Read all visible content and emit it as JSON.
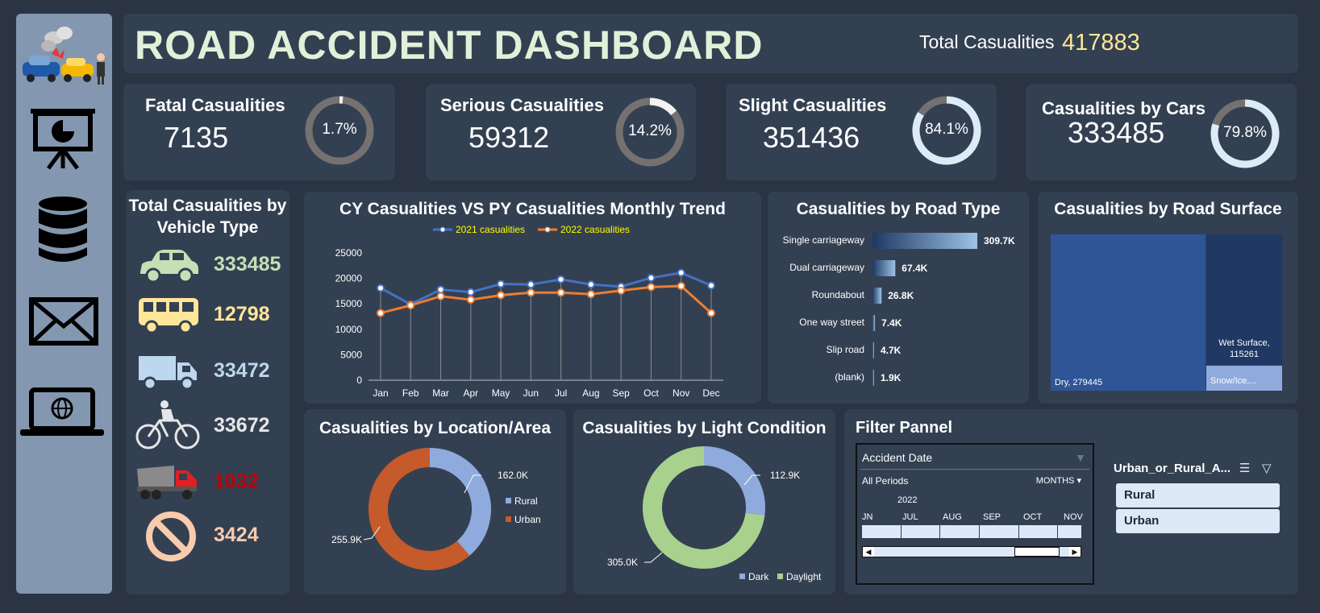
{
  "header": {
    "title": "ROAD ACCIDENT DASHBOARD",
    "total_label": "Total Casualities",
    "total_value": "417883"
  },
  "sidebar": {
    "icons": [
      "crash-logo-icon",
      "presentation-chart-icon",
      "database-icon",
      "mail-icon",
      "laptop-globe-icon"
    ]
  },
  "kpis": {
    "fatal": {
      "title": "Fatal Casualities",
      "value": "7135",
      "pct_label": "1.7%",
      "pct": 1.7
    },
    "serious": {
      "title": "Serious Casualities",
      "value": "59312",
      "pct_label": "14.2%",
      "pct": 14.2
    },
    "slight": {
      "title": "Slight Casualities",
      "value": "351436",
      "pct_label": "84.1%",
      "pct": 84.1
    },
    "cars": {
      "title": "Casualities by Cars",
      "value": "333485",
      "pct_label": "79.8%",
      "pct": 79.8
    }
  },
  "vehicles": {
    "title": "Total Casualities by Vehicle Type",
    "items": [
      {
        "icon": "car-icon",
        "value": "333485",
        "color": "#c5e0b4"
      },
      {
        "icon": "bus-icon",
        "value": "12798",
        "color": "#ffe699"
      },
      {
        "icon": "truck-icon",
        "value": "33472",
        "color": "#bdd7ee"
      },
      {
        "icon": "bicycle-icon",
        "value": "33672",
        "color": "#e7e6e6"
      },
      {
        "icon": "dump-truck-icon",
        "value": "1032",
        "color": "#c00000"
      },
      {
        "icon": "prohibited-icon",
        "value": "3424",
        "color": "#f8cbad"
      }
    ]
  },
  "chart_data": [
    {
      "type": "line",
      "title": "CY Casualities VS PY Casualities Monthly Trend",
      "categories": [
        "Jan",
        "Feb",
        "Mar",
        "Apr",
        "May",
        "Jun",
        "Jul",
        "Aug",
        "Sep",
        "Oct",
        "Nov",
        "Dec"
      ],
      "series": [
        {
          "name": "2021 casualities",
          "color": "#4472c4",
          "values": [
            18100,
            14900,
            17800,
            17300,
            18900,
            18800,
            19800,
            18800,
            18400,
            20100,
            21100,
            18600
          ]
        },
        {
          "name": "2022 casualities",
          "color": "#ed7d31",
          "values": [
            13200,
            14700,
            16500,
            15800,
            16700,
            17200,
            17200,
            16900,
            17600,
            18300,
            18500,
            13200
          ]
        }
      ],
      "ylim": [
        0,
        25000
      ],
      "yticks": [
        "25000",
        "20000",
        "15000",
        "10000",
        "5000",
        "0"
      ],
      "legend": "top"
    },
    {
      "type": "bar",
      "title": "Casualities by Road Type",
      "categories": [
        "Single carriageway",
        "Dual carriageway",
        "Roundabout",
        "One way street",
        "Slip road",
        "(blank)"
      ],
      "values": [
        309.7,
        67.4,
        26.8,
        7.4,
        4.7,
        1.9
      ],
      "labels": [
        "309.7K",
        "67.4K",
        "26.8K",
        "7.4K",
        "4.7K",
        "1.9K"
      ]
    },
    {
      "type": "heatmap",
      "title": "Casualities by Road Surface",
      "labels": [
        "Dry, 279445",
        "Wet Surface,",
        "115261",
        "Snow/Ice,..."
      ],
      "values": [
        279445,
        115261,
        22000
      ]
    },
    {
      "type": "pie",
      "title": "Casualities by Location/Area",
      "categories": [
        "Rural",
        "Urban"
      ],
      "values": [
        162.0,
        255.9
      ],
      "labels": [
        "162.0K",
        "255.9K"
      ],
      "legend": "right"
    },
    {
      "type": "pie",
      "title": "Casualities by Light Condition",
      "categories": [
        "Dark",
        "Daylight"
      ],
      "values": [
        112.9,
        305.0
      ],
      "labels": [
        "112.9K",
        "305.0K"
      ],
      "legend": "bottom"
    }
  ],
  "filter": {
    "title": "Filter Pannel",
    "timeline": {
      "title": "Accident Date",
      "period": "All Periods",
      "unit": "MONTHS",
      "year": "2022",
      "months": [
        "JN",
        "JUL",
        "AUG",
        "SEP",
        "OCT",
        "NOV"
      ]
    },
    "slicer": {
      "title": "Urban_or_Rural_A...",
      "options": [
        "Rural",
        "Urban"
      ]
    }
  }
}
